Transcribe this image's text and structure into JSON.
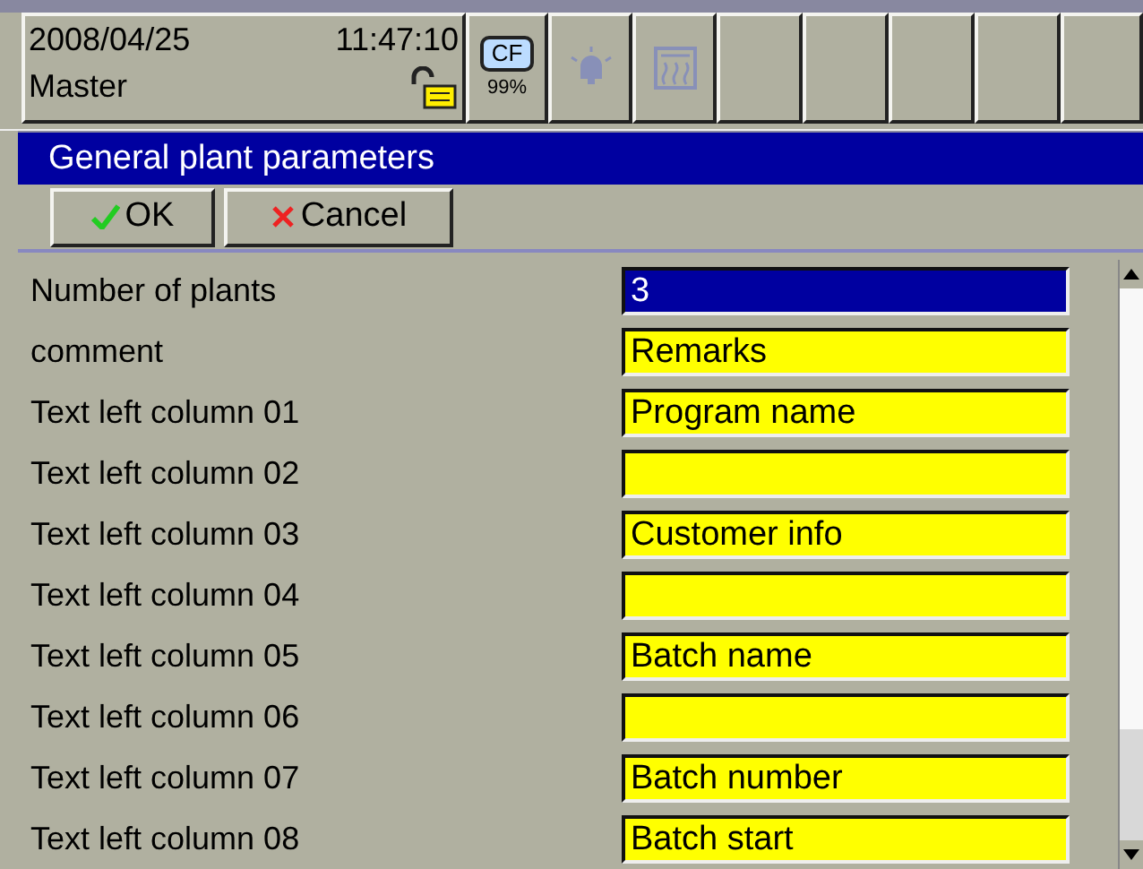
{
  "status": {
    "date": "2008/04/25",
    "time": "11:47:10",
    "user": "Master",
    "locked": false,
    "card_label": "CF",
    "card_usage": "99%"
  },
  "dialog": {
    "title": "General plant parameters",
    "buttons": [
      {
        "kind": "ok",
        "label": "OK"
      },
      {
        "kind": "cancel",
        "label": "Cancel"
      }
    ]
  },
  "rows": [
    {
      "label": "Number of plants",
      "value": "3",
      "selected": true
    },
    {
      "label": "comment",
      "value": "Remarks",
      "selected": false
    },
    {
      "label": "Text left column 01",
      "value": "Program name",
      "selected": false
    },
    {
      "label": "Text left column 02",
      "value": "",
      "selected": false
    },
    {
      "label": "Text left column 03",
      "value": "Customer info",
      "selected": false
    },
    {
      "label": "Text left column 04",
      "value": "",
      "selected": false
    },
    {
      "label": "Text left column 05",
      "value": "Batch name",
      "selected": false
    },
    {
      "label": "Text left column 06",
      "value": "",
      "selected": false
    },
    {
      "label": "Text left column 07",
      "value": "Batch number",
      "selected": false
    },
    {
      "label": "Text left column 08",
      "value": "Batch start",
      "selected": false
    }
  ]
}
